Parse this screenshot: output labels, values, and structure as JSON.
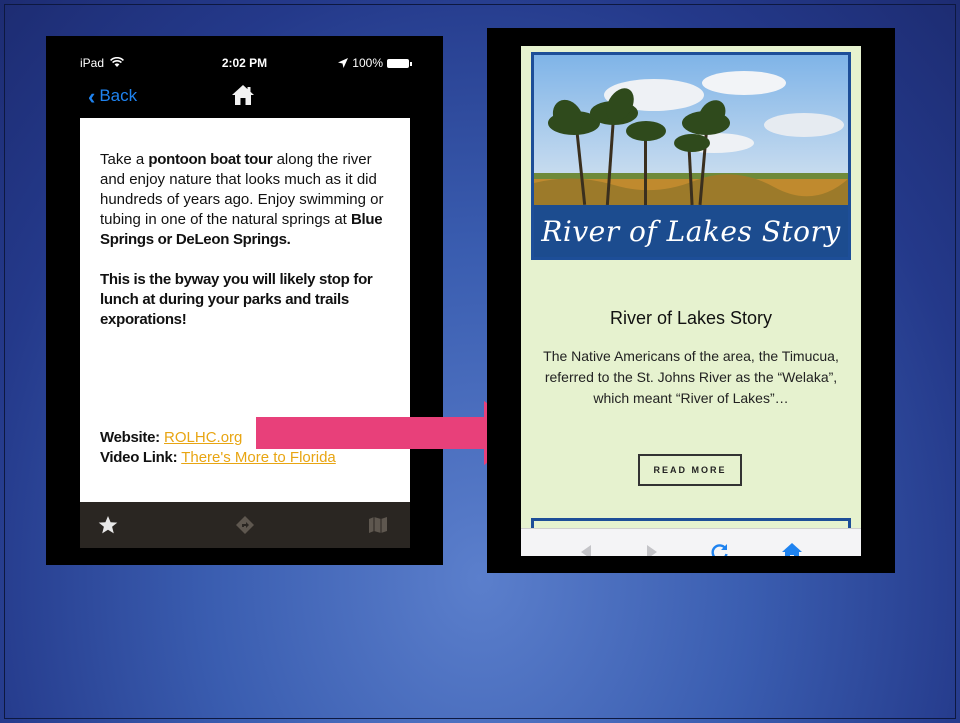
{
  "left_phone": {
    "status_bar": {
      "device": "iPad",
      "wifi_icon": "wifi-icon",
      "time": "2:02 PM",
      "battery": "100%"
    },
    "nav": {
      "back_label": "Back",
      "home_icon": "home-icon"
    },
    "content": {
      "p1_a": "Take a ",
      "p1_b": "pontoon boat tour",
      "p1_c": " along the river and enjoy nature that looks much as it did hundreds of years ago. Enjoy swimming or tubing in one of the natural springs at ",
      "p1_d": "Blue Springs or DeLeon Springs.",
      "p2": "This is the byway you will likely stop for lunch at during your parks and trails exporations!",
      "website_label": "Website:",
      "website_link": "ROLHC.org",
      "video_label": "Video Link:",
      "video_link": "There's More to Florida"
    },
    "tabs": [
      "star-icon",
      "directions-icon",
      "map-icon"
    ]
  },
  "right_phone": {
    "hero_banner": "River of Lakes Story",
    "story_title": "River of Lakes Story",
    "story_body": "The Native Americans of the area, the Timucua, referred to the St. Johns River as the “Welaka”, which meant “River of Lakes”…",
    "read_more": "READ MORE",
    "browser_bar": [
      "back-arrow-icon",
      "forward-arrow-icon",
      "reload-icon",
      "home-icon"
    ]
  },
  "colors": {
    "ios_blue": "#1f83f0",
    "link_gold": "#e8a512",
    "arrow_pink": "#e8407a",
    "banner_blue": "#1c4c8f",
    "page_green": "#e6f2cf"
  }
}
